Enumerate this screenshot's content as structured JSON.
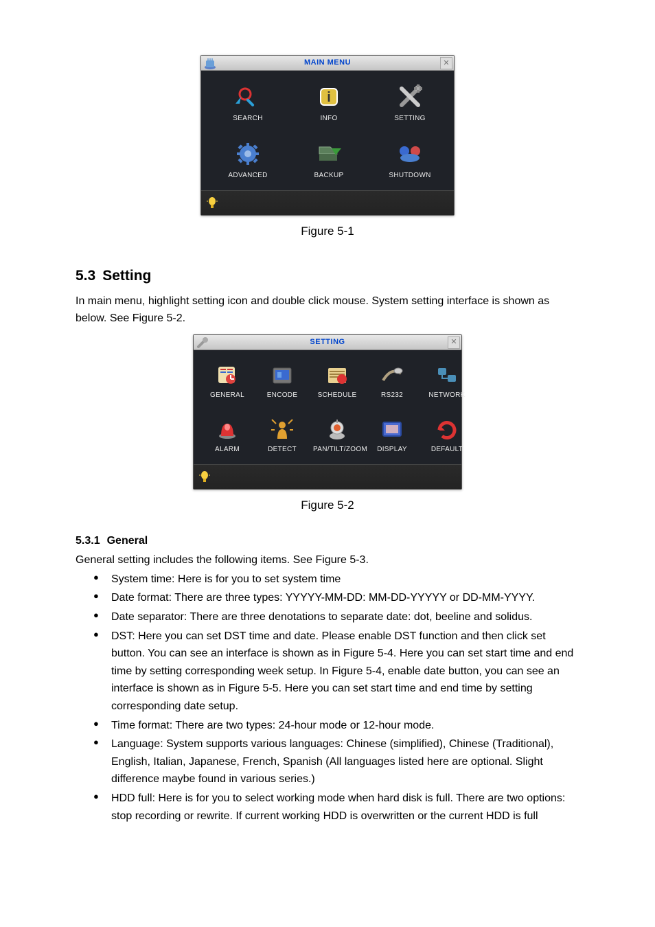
{
  "fig1": {
    "title": "MAIN MENU",
    "items": [
      {
        "label": "SEARCH",
        "icon": "search"
      },
      {
        "label": "INFO",
        "icon": "info"
      },
      {
        "label": "SETTING",
        "icon": "setting"
      },
      {
        "label": "ADVANCED",
        "icon": "advanced"
      },
      {
        "label": "BACKUP",
        "icon": "backup"
      },
      {
        "label": "SHUTDOWN",
        "icon": "shutdown"
      }
    ],
    "caption": "Figure 5-1"
  },
  "section": {
    "num": "5.3",
    "title": "Setting",
    "intro": "In main menu, highlight setting icon and double click mouse. System setting interface is shown as below. See Figure 5-2."
  },
  "fig2": {
    "title": "SETTING",
    "items": [
      {
        "label": "GENERAL",
        "icon": "general"
      },
      {
        "label": "ENCODE",
        "icon": "encode"
      },
      {
        "label": "SCHEDULE",
        "icon": "schedule"
      },
      {
        "label": "RS232",
        "icon": "rs232"
      },
      {
        "label": "NETWORK",
        "icon": "network"
      },
      {
        "label": "ALARM",
        "icon": "alarm"
      },
      {
        "label": "DETECT",
        "icon": "detect"
      },
      {
        "label": "PAN/TILT/ZOOM",
        "icon": "ptz"
      },
      {
        "label": "DISPLAY",
        "icon": "display"
      },
      {
        "label": "DEFAULT",
        "icon": "default"
      }
    ],
    "caption": "Figure 5-2"
  },
  "sub": {
    "num": "5.3.1",
    "title": "General",
    "intro": "General setting includes the following items. See Figure 5-3.",
    "bullets": [
      "System time: Here is for you to set system time",
      "Date format: There are three types: YYYYY-MM-DD: MM-DD-YYYYY or DD-MM-YYYY.",
      "Date separator: There are three denotations to separate date: dot, beeline and solidus.",
      "DST: Here you can set DST time and date. Please enable DST function and then click set button. You can see an interface is shown as in Figure 5-4. Here you can set start time and end time by setting corresponding week setup. In Figure 5-4, enable date button, you can see an interface is shown as in Figure 5-5. Here you can set start time and end time by setting corresponding date setup.",
      "Time format: There are two types: 24-hour mode or 12-hour mode.",
      "Language: System supports various languages: Chinese (simplified), Chinese (Traditional), English, Italian, Japanese, French, Spanish (All languages listed here are optional. Slight difference maybe found in various series.)",
      "HDD full: Here is for you to select working mode when hard disk is full. There are two options: stop recording or rewrite. If current working HDD is overwritten or the current HDD is full"
    ]
  }
}
